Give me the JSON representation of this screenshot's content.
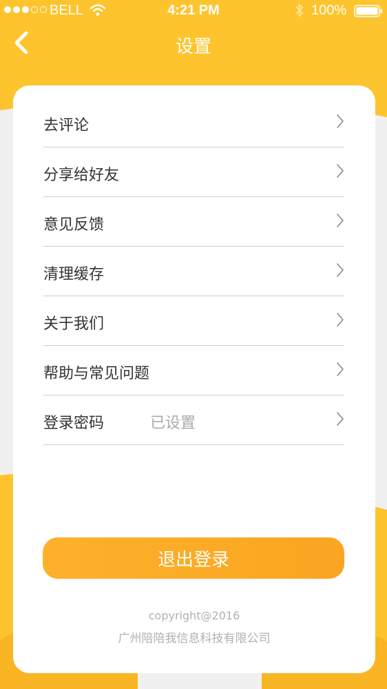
{
  "status_bar": {
    "carrier": "BELL",
    "time": "4:21 PM",
    "battery_percent": "100%",
    "signal_icon": "signal-dots-icon",
    "wifi_icon": "wifi-icon",
    "bluetooth_icon": "bluetooth-icon",
    "battery_icon": "battery-icon"
  },
  "nav": {
    "title": "设置",
    "back_icon": "chevron-left-icon"
  },
  "menu": {
    "items": [
      {
        "label": "去评论",
        "value": ""
      },
      {
        "label": "分享给好友",
        "value": ""
      },
      {
        "label": "意见反馈",
        "value": ""
      },
      {
        "label": "清理缓存",
        "value": ""
      },
      {
        "label": "关于我们",
        "value": ""
      },
      {
        "label": "帮助与常见问题",
        "value": ""
      },
      {
        "label": "登录密码",
        "value": "已设置"
      }
    ],
    "chevron_icon": "chevron-right-icon"
  },
  "logout": {
    "label": "退出登录"
  },
  "footer": {
    "copyright": "copyright@2016",
    "company": "广州陪陪我信息科技有限公司"
  },
  "colors": {
    "accent": "#fec22e",
    "button": "#fcab25",
    "text": "#333333",
    "muted": "#aaaaaa"
  }
}
